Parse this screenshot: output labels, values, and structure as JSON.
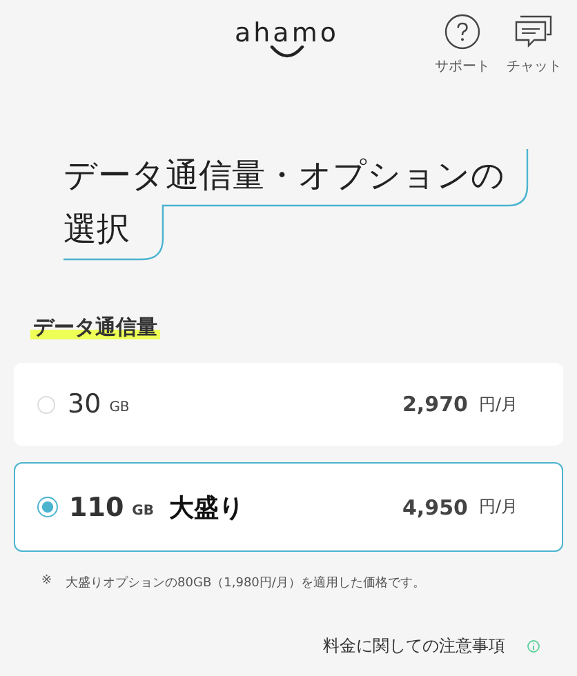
{
  "header": {
    "logo": "ahamo",
    "nav": [
      {
        "kind": "support",
        "label": "サポート"
      },
      {
        "kind": "chat",
        "label": "チャット"
      }
    ]
  },
  "title_lines": [
    "データ通信量・オプションの",
    "選択"
  ],
  "section_label": "データ通信量",
  "plans": [
    {
      "amount": "30",
      "unit": "GB",
      "price": "2,970",
      "price_unit": "円/月",
      "selected": false
    },
    {
      "amount": "110",
      "unit": "GB",
      "badge": "大盛り",
      "price": "4,950",
      "price_unit": "円/月",
      "selected": true
    }
  ],
  "note": {
    "mark": "※",
    "text": "大盛りオプションの80GB（1,980円/月）を適用した価格です。"
  },
  "link": "料金に関しての注意事項"
}
